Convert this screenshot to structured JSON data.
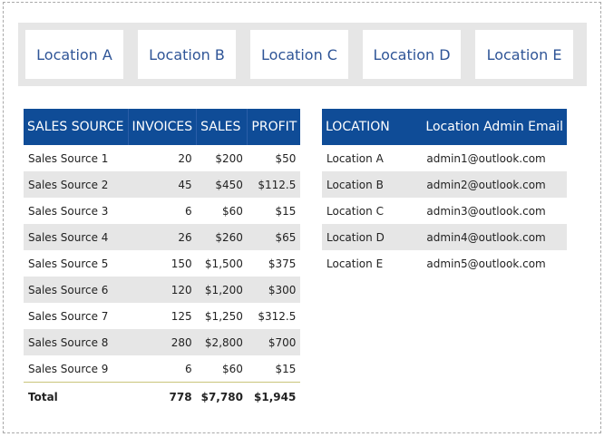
{
  "slicer": {
    "items": [
      "Location A",
      "Location B",
      "Location C",
      "Location D",
      "Location E"
    ]
  },
  "sales_table": {
    "headers": [
      "SALES SOURCE",
      "INVOICES",
      "SALES",
      "PROFIT"
    ],
    "rows": [
      [
        "Sales Source 1",
        "20",
        "$200",
        "$50"
      ],
      [
        "Sales Source 2",
        "45",
        "$450",
        "$112.5"
      ],
      [
        "Sales Source 3",
        "6",
        "$60",
        "$15"
      ],
      [
        "Sales Source 4",
        "26",
        "$260",
        "$65"
      ],
      [
        "Sales Source 5",
        "150",
        "$1,500",
        "$375"
      ],
      [
        "Sales Source 6",
        "120",
        "$1,200",
        "$300"
      ],
      [
        "Sales Source 7",
        "125",
        "$1,250",
        "$312.5"
      ],
      [
        "Sales Source 8",
        "280",
        "$2,800",
        "$700"
      ],
      [
        "Sales Source 9",
        "6",
        "$60",
        "$15"
      ]
    ],
    "total": [
      "Total",
      "778",
      "$7,780",
      "$1,945"
    ]
  },
  "location_table": {
    "headers": [
      "LOCATION",
      "Location Admin Email"
    ],
    "rows": [
      [
        "Location A",
        "admin1@outlook.com"
      ],
      [
        "Location B",
        "admin2@outlook.com"
      ],
      [
        "Location C",
        "admin3@outlook.com"
      ],
      [
        "Location D",
        "admin4@outlook.com"
      ],
      [
        "Location E",
        "admin5@outlook.com"
      ]
    ]
  },
  "colors": {
    "header_bg": "#0f4c97",
    "slicer_text": "#2f5597",
    "alt_row": "#e6e6e6"
  }
}
